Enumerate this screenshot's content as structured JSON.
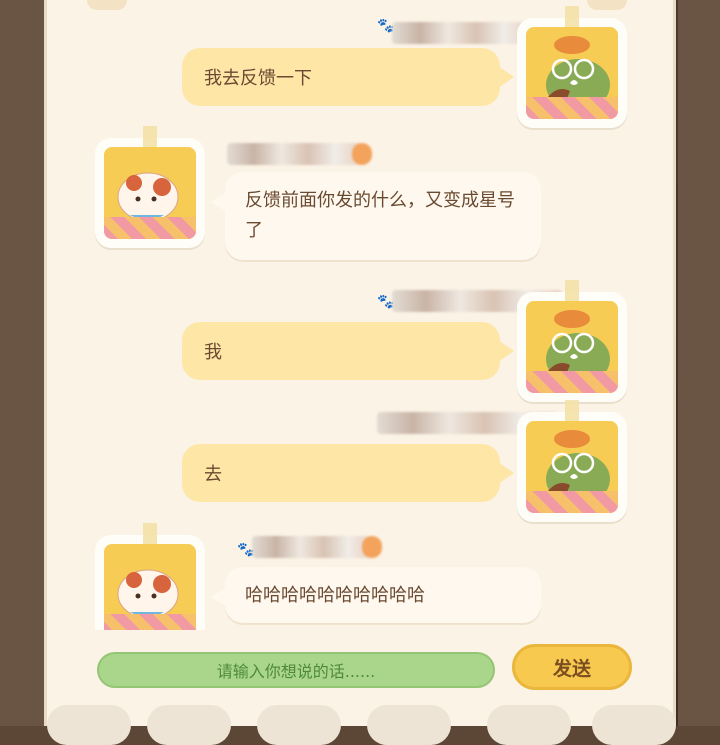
{
  "messages": [
    {
      "side": "right",
      "avatar": "frog-avatar",
      "text": "我去反馈一下"
    },
    {
      "side": "left",
      "avatar": "cat-avatar",
      "text": "反馈前面你发的什么，又变成星号了"
    },
    {
      "side": "right",
      "avatar": "frog-avatar",
      "text": "我"
    },
    {
      "side": "right",
      "avatar": "frog-avatar",
      "text": "去"
    },
    {
      "side": "left",
      "avatar": "cat-avatar",
      "text": "哈哈哈哈哈哈哈哈哈哈"
    }
  ],
  "input": {
    "placeholder": "请输入你想说的话......"
  },
  "send_label": "发送",
  "colors": {
    "panel": "#fbf3e6",
    "bubble_right": "#fde6a6",
    "bubble_left": "#fff8ef",
    "input_bg": "#a9d68a",
    "send_bg": "#f8c94f"
  }
}
